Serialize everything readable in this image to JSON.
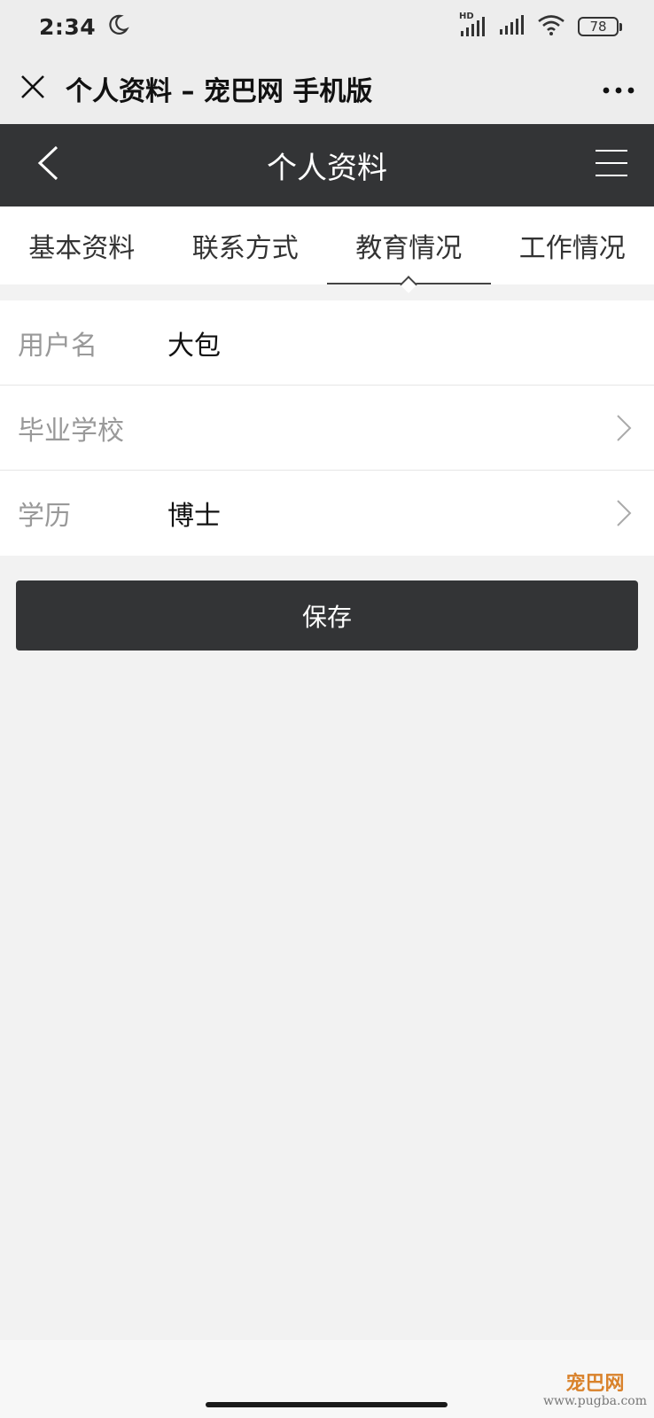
{
  "status_bar": {
    "time": "2:34",
    "battery": "78",
    "network_badge": "HD"
  },
  "webview": {
    "title": "个人资料 – 宠巴网 手机版"
  },
  "header": {
    "title": "个人资料"
  },
  "tabs": [
    {
      "label": "基本资料",
      "active": false
    },
    {
      "label": "联系方式",
      "active": false
    },
    {
      "label": "教育情况",
      "active": true
    },
    {
      "label": "工作情况",
      "active": false
    }
  ],
  "form": {
    "rows": [
      {
        "label": "用户名",
        "value": "大包",
        "has_chevron": false
      },
      {
        "label": "毕业学校",
        "value": "",
        "has_chevron": true
      },
      {
        "label": "学历",
        "value": "博士",
        "has_chevron": true
      }
    ]
  },
  "save_button": {
    "label": "保存"
  },
  "watermark": {
    "logo": "宠巴网",
    "url": "www.pugba.com"
  },
  "colors": {
    "header_bg": "#333436",
    "page_bg": "#f2f2f2",
    "watermark_orange": "#d9822b"
  }
}
